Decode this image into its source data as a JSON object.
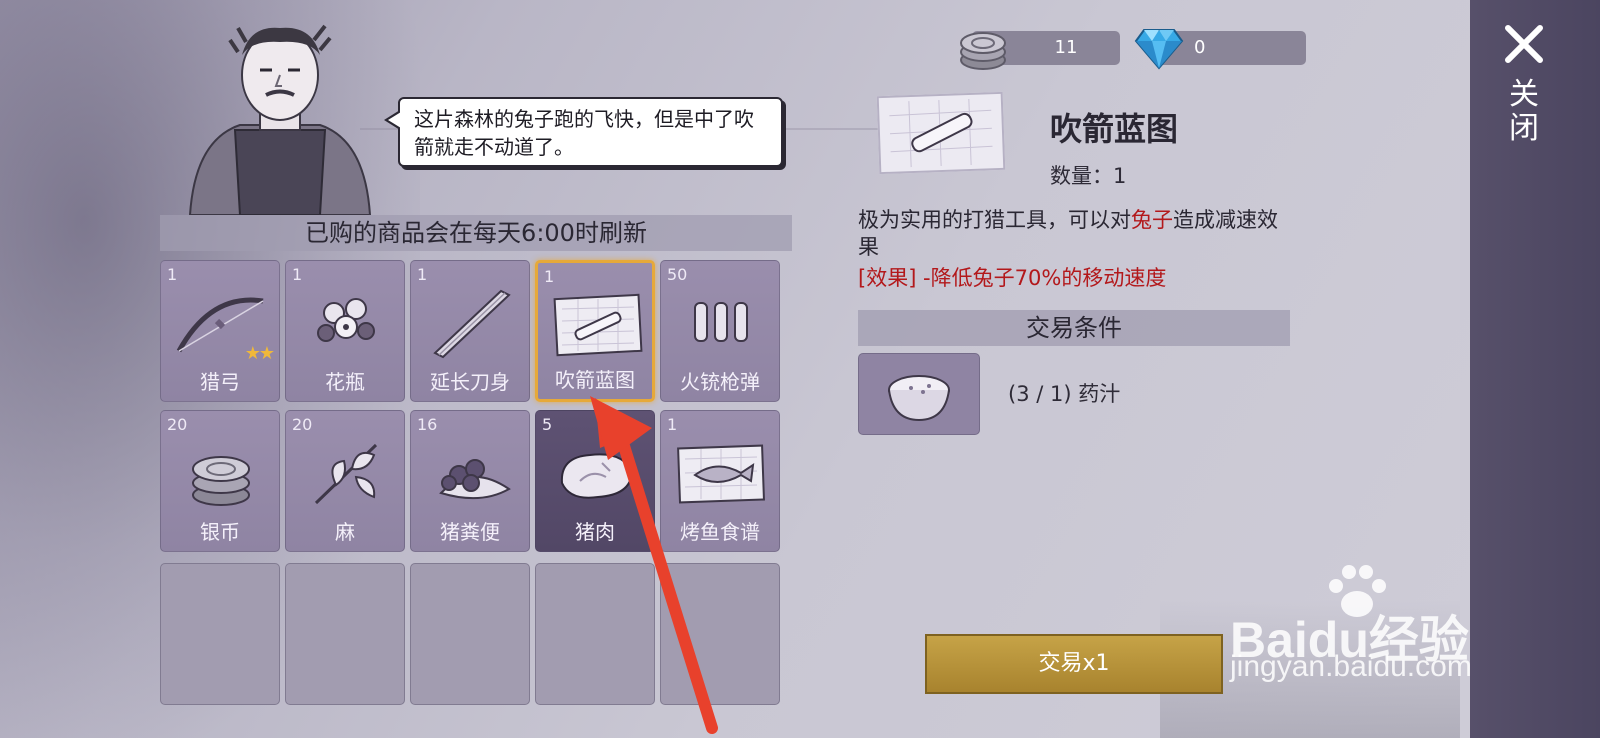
{
  "currency": {
    "silver": "11",
    "gems": "0"
  },
  "npc": {
    "speech": "这片森林的兔子跑的飞快，但是中了吹箭就走不动道了。"
  },
  "shop": {
    "refresh_note": "已购的商品会在每天6:00时刷新",
    "items": [
      {
        "qty": "1",
        "name": "猎弓",
        "icon": "bow-icon",
        "stars": 2
      },
      {
        "qty": "1",
        "name": "花瓶",
        "icon": "flower-icon"
      },
      {
        "qty": "1",
        "name": "延长刀身",
        "icon": "blade-icon"
      },
      {
        "qty": "1",
        "name": "吹箭蓝图",
        "icon": "blueprint-icon",
        "selected": true
      },
      {
        "qty": "50",
        "name": "火铳枪弹",
        "icon": "bullets-icon"
      },
      {
        "qty": "20",
        "name": "银币",
        "icon": "coins-icon"
      },
      {
        "qty": "20",
        "name": "麻",
        "icon": "hemp-icon"
      },
      {
        "qty": "16",
        "name": "猪粪便",
        "icon": "dung-icon"
      },
      {
        "qty": "5",
        "name": "猪肉",
        "icon": "pork-icon"
      },
      {
        "qty": "1",
        "name": "烤鱼食谱",
        "icon": "fish-recipe-icon"
      }
    ]
  },
  "detail": {
    "title": "吹箭蓝图",
    "count": "数量：1",
    "desc_pre": "极为实用的打猎工具，可以对",
    "desc_target": "兔子",
    "desc_post": "造成减速效果",
    "effect": "[效果] -降低兔子70%的移动速度",
    "trade_header": "交易条件",
    "requirement": "(3 / 1) 药汁",
    "trade_button": "交易x1"
  },
  "close": {
    "label": "关闭"
  },
  "watermark": {
    "brand": "Baidu经验",
    "url": "jingyan.baidu.com"
  },
  "colors": {
    "slot": "#8f84a3",
    "selected_border": "#e6a93a",
    "highlight_red": "#b3181b",
    "trade_button": "#b8942f",
    "close_panel": "#4f4963",
    "annotation_arrow": "#e8412c"
  }
}
